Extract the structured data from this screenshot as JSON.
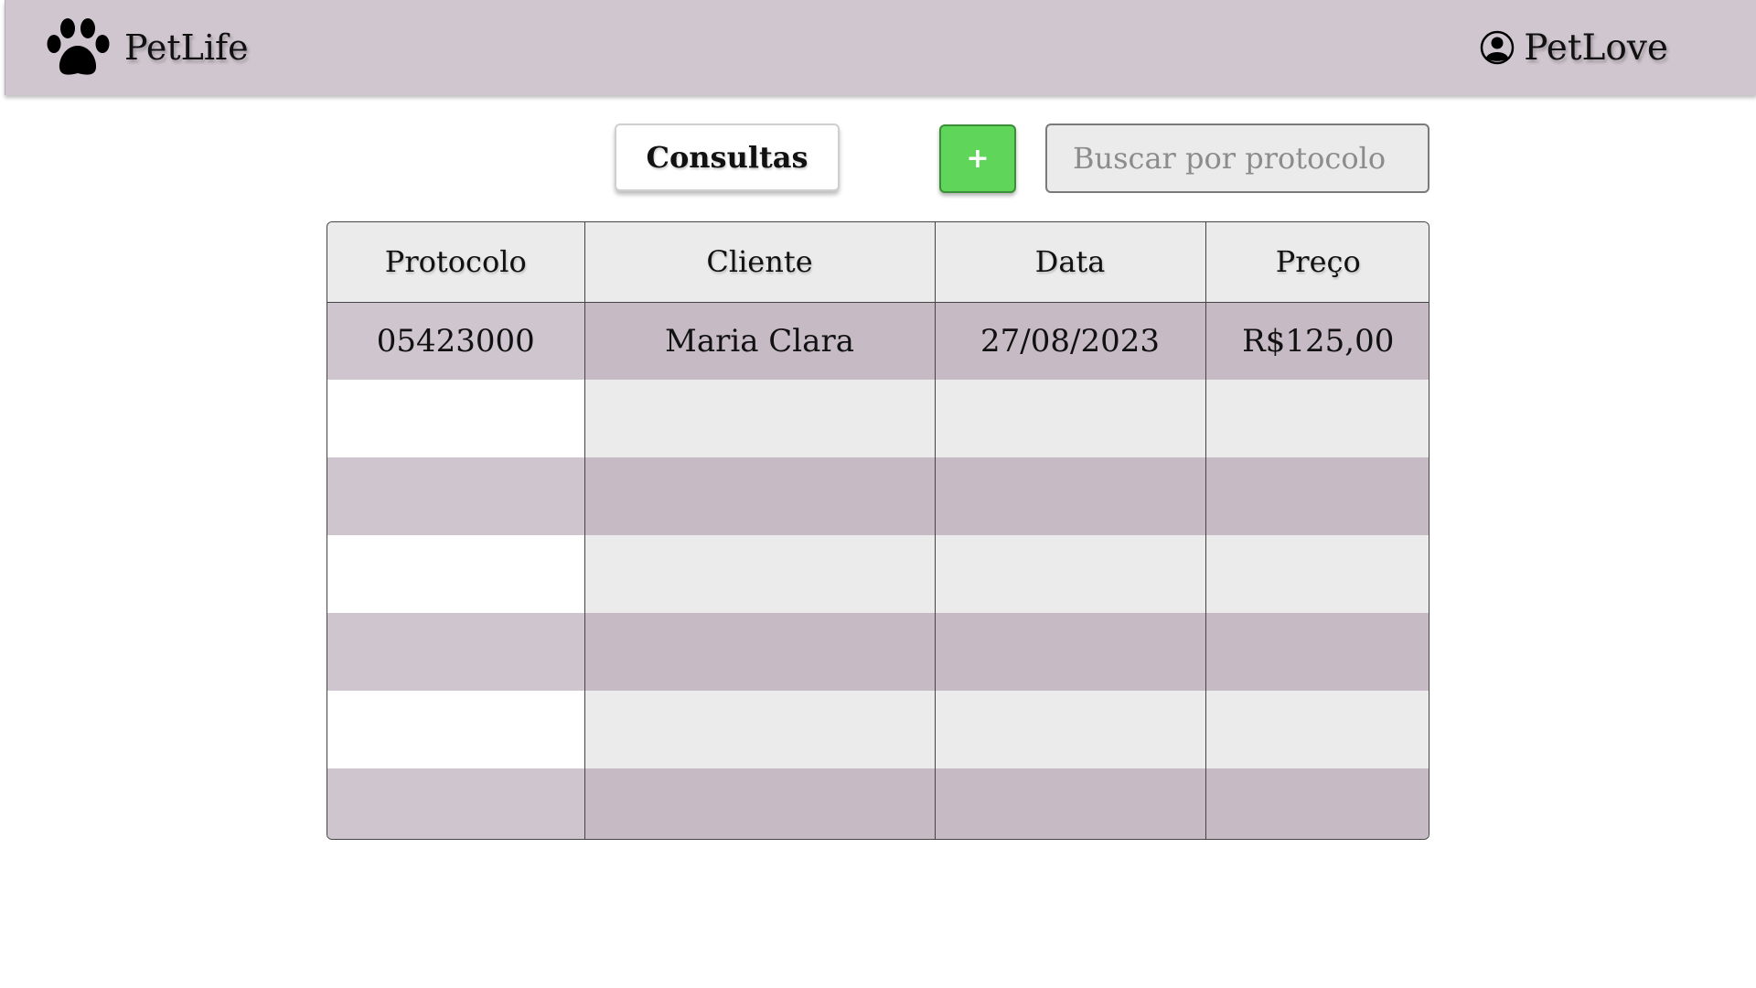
{
  "header": {
    "brand": "PetLife",
    "brand_icon": "paw-icon",
    "user": "PetLove",
    "user_icon": "user-circle-icon",
    "background": "#d0c6cf"
  },
  "toolbar": {
    "tab_label": "Consultas",
    "add_label": "+",
    "add_color": "#5fd65a",
    "search_placeholder": "Buscar por protocolo",
    "search_value": ""
  },
  "table": {
    "columns": [
      "Protocolo",
      "Cliente",
      "Data",
      "Preço"
    ],
    "rows": [
      [
        "05423000",
        "Maria Clara",
        "27/08/2023",
        "R$125,00"
      ],
      [
        "",
        "",
        "",
        ""
      ],
      [
        "",
        "",
        "",
        ""
      ],
      [
        "",
        "",
        "",
        ""
      ],
      [
        "",
        "",
        "",
        ""
      ],
      [
        "",
        "",
        "",
        ""
      ],
      [
        "",
        "",
        "",
        ""
      ]
    ]
  }
}
